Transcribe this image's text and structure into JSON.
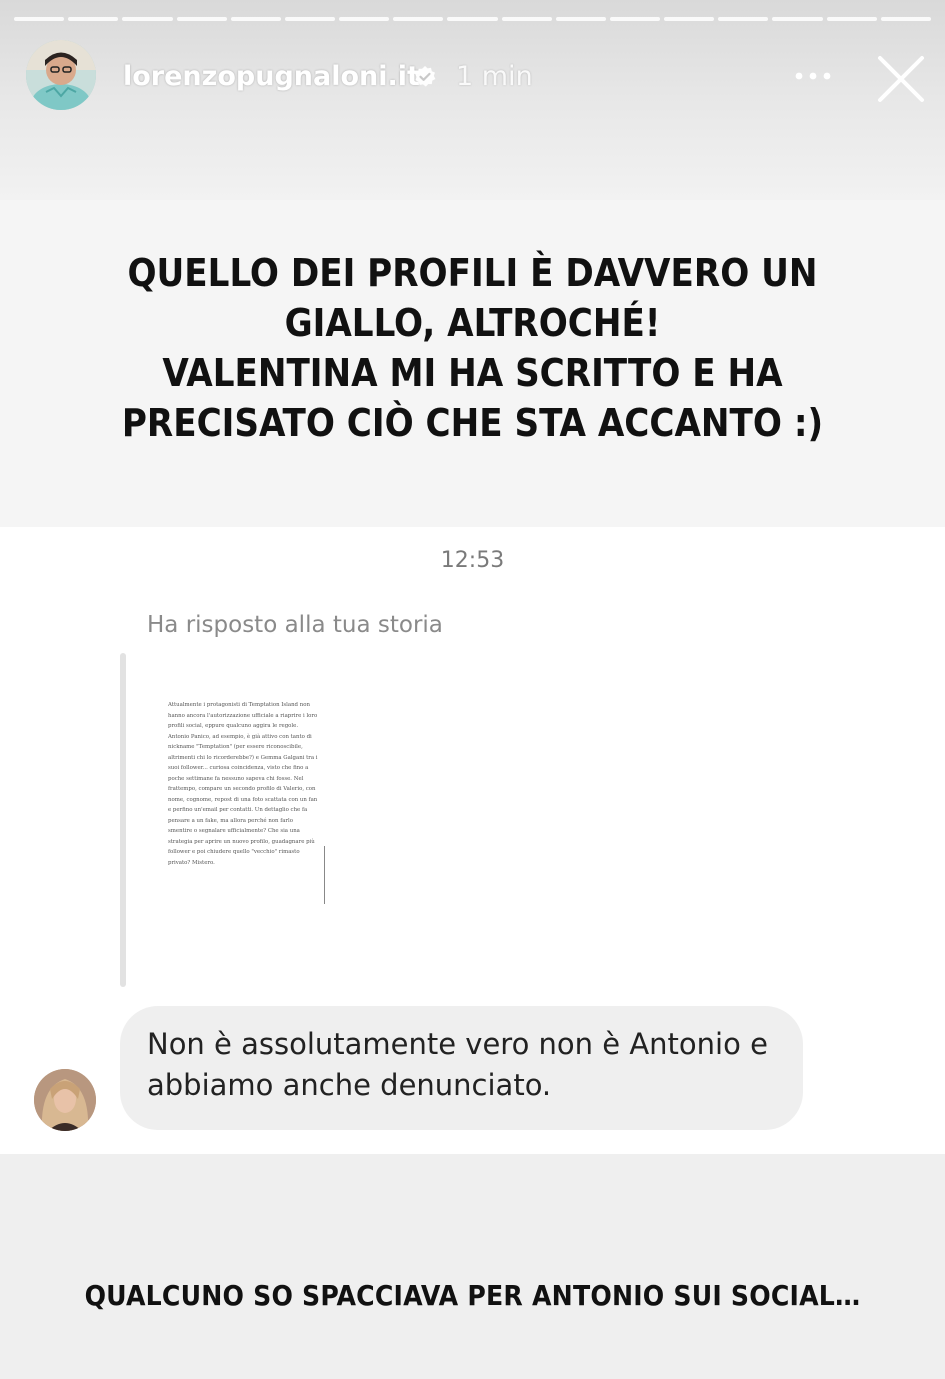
{
  "story": {
    "progress_segments": 17,
    "username": "lorenzopugnaloni.it",
    "time_ago": "1 min",
    "verified_icon": "verified-badge-icon",
    "more_icon": "more-dots-icon",
    "close_icon": "close-icon"
  },
  "headline": {
    "line1": "QUELLO DEI PROFILI È DAVVERO UN",
    "line2": "GIALLO, ALTROCHÉ!",
    "line3": "VALENTINA MI HA SCRITTO E HA",
    "line4": "PRECISATO CIÒ CHE STA ACCANTO :)"
  },
  "chat": {
    "time": "12:53",
    "reply_label": "Ha risposto alla tua storia",
    "quoted_story_text": "Attualmente i protagonisti di Temptation Island non hanno ancora l'autorizzazione ufficiale a riaprire i loro profili social, eppure qualcuno aggira le regole. Antonio Panico, ad esempio, è già attivo con tanto di nickname \"Temptation\" (per essere riconoscibile, altrimenti chi lo ricorderebbe?) e Gemma Galgani tra i suoi follower... curiosa coincidenza, visto che fino a poche settimane fa nessuno sapeva chi fosse. Nel frattempo, compare un secondo profilo di Valerio, con nome, cognome, repost di una foto scattata con un fan e perfino un'email per contatti. Un dettaglio che fa pensare a un fake, ma allora perché non farlo smentire o segnalare ufficialmente? Che sia una strategia per aprire un nuovo profilo, guadagnare più follower e poi chiudere quello \"vecchio\" rimasto privato? Mistero.",
    "message": "Non è assolutamente vero non è Antonio e abbiamo anche denunciato."
  },
  "footer": {
    "caption": "QUALCUNO SO SPACCIAVA PER ANTONIO SUI SOCIAL…"
  },
  "colors": {
    "panel_bg": "#ffffff",
    "story_bg": "#f5f5f5",
    "bubble_bg": "#efefef",
    "text_dark": "#111111",
    "muted": "#8a8a8a"
  }
}
